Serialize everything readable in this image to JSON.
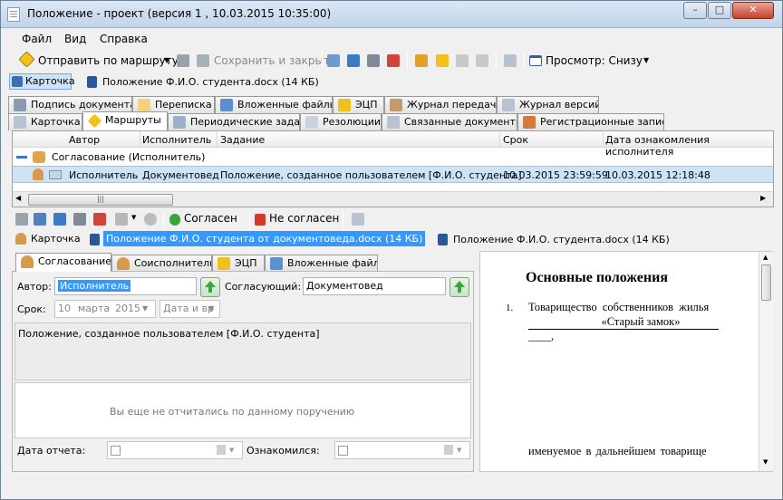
{
  "window": {
    "title": "Положение - проект (версия 1 , 10.03.2015 10:35:00)"
  },
  "menu": [
    "Файл",
    "Вид",
    "Справка"
  ],
  "toolbar": {
    "send": "Отправить по маршруту",
    "save_close": "Сохранить и закрыть",
    "preview": "Просмотр: Снизу"
  },
  "card": {
    "tab": "Карточка",
    "file": "Положение Ф.И.О. студента.docx (14 КБ)"
  },
  "tabs_top": [
    "Подпись документа",
    "Переписка",
    "Вложенные файлы",
    "ЭЦП",
    "Журнал передачи",
    "Журнал версий"
  ],
  "tabs_bottom": [
    "Карточка",
    "Маршруты",
    "Периодические задачи",
    "Резолюции",
    "Связанные документы",
    "Регистрационные записи"
  ],
  "grid": {
    "headers": [
      "Автор",
      "Исполнитель",
      "Задание",
      "Срок",
      "Дата ознакомления исполнителя"
    ],
    "group": "Согласование (Исполнитель)",
    "row": {
      "author": "Исполнитель",
      "executor": "Документовед",
      "task": "Положение, созданное пользователем [Ф.И.О. студента]",
      "deadline": "10.03.2015 23:59:59",
      "ack": "10.03.2015 12:18:48"
    }
  },
  "task_toolbar": {
    "agree": "Согласен",
    "disagree": "Не согласен"
  },
  "task_card": {
    "tab": "Карточка",
    "file_selected": "Положение Ф.И.О. студента от документоведа.docx (14 КБ)",
    "file_other": "Положение Ф.И.О. студента.docx (14 КБ)"
  },
  "inner_tabs": [
    "Согласование",
    "Соисполнители",
    "ЭЦП",
    "Вложенные файлы"
  ],
  "form": {
    "author_label": "Автор:",
    "author_value": "Исполнитель",
    "approver_label": "Согласующий:",
    "approver_value": "Документовед",
    "deadline_label": "Срок:",
    "deadline_day": "10",
    "deadline_month": "марта",
    "deadline_year": "2015",
    "date_select": "Дата и вр",
    "description": "Положение, созданное пользователем [Ф.И.О. студента]",
    "report_placeholder": "Вы еще не отчитались по данному поручению",
    "report_date_label": "Дата отчета:",
    "acquainted_label": "Ознакомился:"
  },
  "doc": {
    "heading": "Основные положения",
    "item_num": "1.",
    "item_text": "Товарищество собственников жилья",
    "quote": "«Старый замок»",
    "tail": "____,",
    "bottom": "именуемое в дальнейшем товарище"
  }
}
